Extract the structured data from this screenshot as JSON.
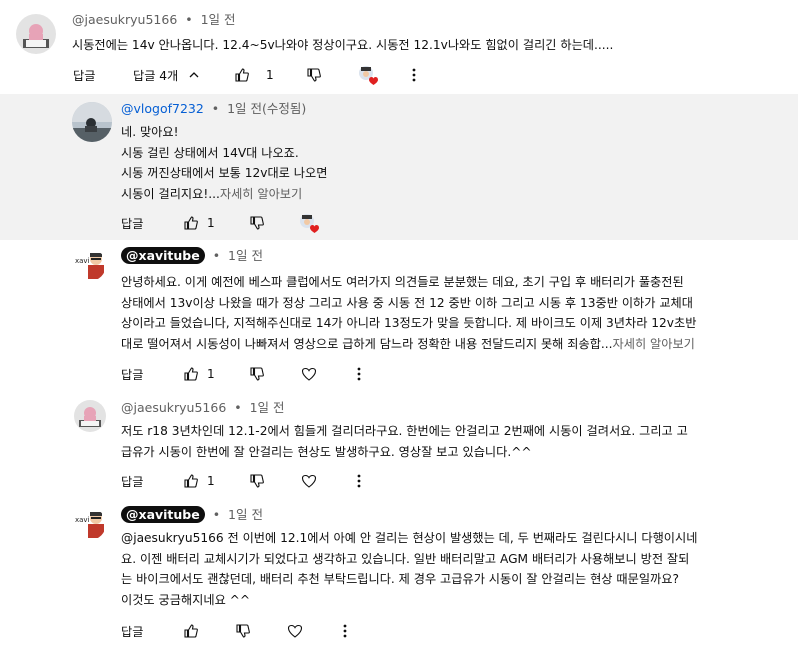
{
  "labels": {
    "reply": "답글",
    "more": "자세히 알아보기"
  },
  "comments": [
    {
      "author": "@jaesukryu5166",
      "time": "1일 전",
      "text": [
        "시동전에는 14v 안나옵니다. 12.4~5v나와야 정상이구요. 시동전 12.1v나와도 힘없이 걸리긴 하는데....."
      ],
      "replies_label": "답글 4개",
      "likes": "1"
    },
    {
      "author": "@vlogof7232",
      "time": "1일 전(수정됨)",
      "text": [
        "네. 맞아요!",
        "시동 걸린 상태에서 14V대 나오죠.",
        "시동 꺼진상태에서 보통 12v대로 나오면",
        "시동이 걸리지요!..."
      ],
      "likes": "1"
    },
    {
      "author": "@xavitube",
      "time": "1일 전",
      "text": [
        "안녕하세요. 이게 예전에 베스파 클럽에서도 여러가지 의견들로 분분했는 데요, 초기 구입 후 배터리가 풀충전된",
        "상태에서 13v이상 나왔을 때가 정상 그리고 사용 중 시동 전 12 중반 이하 그리고 시동 후 13중반 이하가 교체대",
        "상이라고 들었습니다, 지적해주신대로 14가 아니라 13정도가 맞을 듯합니다. 제 바이크도 이제 3년차라 12v초반",
        "대로 떨어져서 시동성이 나빠져서 영상으로 급하게 담느라 정확한 내용 전달드리지 못해 죄송합..."
      ],
      "likes": "1"
    },
    {
      "author": "@jaesukryu5166",
      "time": "1일 전",
      "text": [
        "저도  r18 3년차인데 12.1-2에서 힘들게 걸리더라구요. 한번에는 안걸리고 2번째에 시동이 걸려서요. 그리고  고",
        "급유가 시동이 한번에 잘 안걸리는 현상도 발생하구요. 영상잘 보고 있습니다.^^"
      ],
      "likes": "1"
    },
    {
      "author": "@xavitube",
      "time": "1일 전",
      "text": [
        " @jaesukryu5166  전 이번에 12.1에서 아예 안 걸리는 현상이 발생했는 데, 두 번째라도 걸린다시니 다행이시네",
        "요. 이젠 배터리 교체시기가 되었다고 생각하고 있습니다. 일반 배터리말고 AGM 배터리가 사용해보니 방전 잘되",
        "는 바이크에서도 괜찮던데, 배터리 추천 부탁드립니다. 제 경우 고급유가 시동이 잘 안걸리는 현상 때문일까요?",
        "이것도 궁금해지네요 ^^"
      ],
      "likes": ""
    }
  ]
}
